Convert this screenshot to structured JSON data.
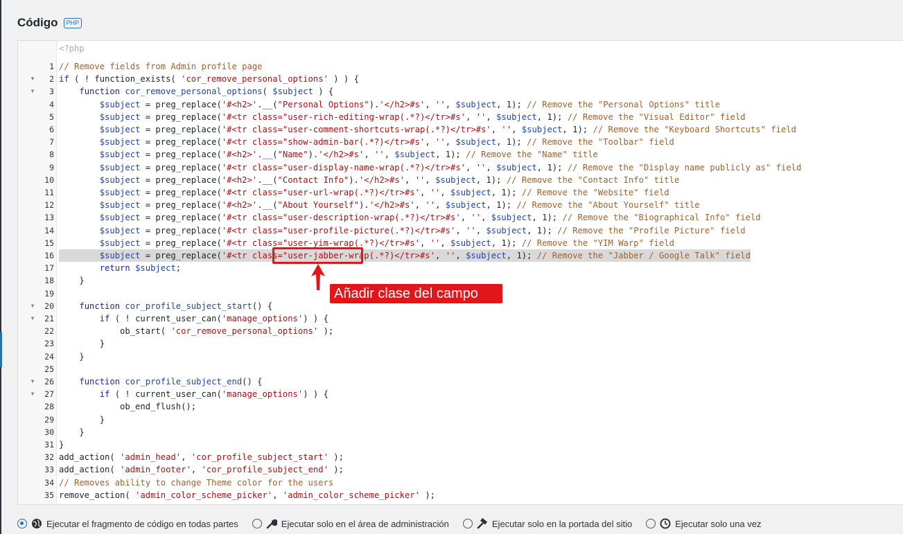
{
  "section": {
    "title": "Código",
    "badge": "PHP"
  },
  "editor": {
    "lines": [
      {
        "num": "",
        "fold": false,
        "html": "<span class=\"c-tag\">&lt;?php</span>"
      },
      {
        "num": "",
        "fold": false,
        "html": ""
      },
      {
        "num": "1",
        "fold": false,
        "html": "<span class=\"c-com\">// Remove fields from Admin profile page</span>"
      },
      {
        "num": "2",
        "fold": true,
        "html": "<span class=\"c-kw\">if</span> ( ! function_exists( <span class=\"c-str\">'cor_remove_personal_options'</span> ) ) {"
      },
      {
        "num": "3",
        "fold": true,
        "html": "    <span class=\"c-kw\">function</span> <span class=\"c-var\">cor_remove_personal_options</span>( <span class=\"c-var\">$subject</span> ) {"
      },
      {
        "num": "4",
        "fold": false,
        "html": "        <span class=\"c-var\">$subject</span> = preg_replace(<span class=\"c-str\">'#&lt;h2&gt;'</span>.__(<span class=\"c-str\">\"Personal Options\"</span>).<span class=\"c-str\">'&lt;/h2&gt;#s'</span>, <span class=\"c-str\">''</span>, <span class=\"c-var\">$subject</span>, 1); <span class=\"c-com\">// Remove the \"Personal Options\" title</span>"
      },
      {
        "num": "5",
        "fold": false,
        "html": "        <span class=\"c-var\">$subject</span> = preg_replace(<span class=\"c-str\">'#&lt;tr class=\"user-rich-editing-wrap(.*?)&lt;/tr&gt;#s'</span>, <span class=\"c-str\">''</span>, <span class=\"c-var\">$subject</span>, 1); <span class=\"c-com\">// Remove the \"Visual Editor\" field</span>"
      },
      {
        "num": "6",
        "fold": false,
        "html": "        <span class=\"c-var\">$subject</span> = preg_replace(<span class=\"c-str\">'#&lt;tr class=\"user-comment-shortcuts-wrap(.*?)&lt;/tr&gt;#s'</span>, <span class=\"c-str\">''</span>, <span class=\"c-var\">$subject</span>, 1); <span class=\"c-com\">// Remove the \"Keyboard Shortcuts\" field</span>"
      },
      {
        "num": "7",
        "fold": false,
        "html": "        <span class=\"c-var\">$subject</span> = preg_replace(<span class=\"c-str\">'#&lt;tr class=\"show-admin-bar(.*?)&lt;/tr&gt;#s'</span>, <span class=\"c-str\">''</span>, <span class=\"c-var\">$subject</span>, 1); <span class=\"c-com\">// Remove the \"Toolbar\" field</span>"
      },
      {
        "num": "8",
        "fold": false,
        "html": "        <span class=\"c-var\">$subject</span> = preg_replace(<span class=\"c-str\">'#&lt;h2&gt;'</span>.__(<span class=\"c-str\">\"Name\"</span>).<span class=\"c-str\">'&lt;/h2&gt;#s'</span>, <span class=\"c-str\">''</span>, <span class=\"c-var\">$subject</span>, 1); <span class=\"c-com\">// Remove the \"Name\" title</span>"
      },
      {
        "num": "9",
        "fold": false,
        "html": "        <span class=\"c-var\">$subject</span> = preg_replace(<span class=\"c-str\">'#&lt;tr class=\"user-display-name-wrap(.*?)&lt;/tr&gt;#s'</span>, <span class=\"c-str\">''</span>, <span class=\"c-var\">$subject</span>, 1); <span class=\"c-com\">// Remove the \"Display name publicly as\" field</span>"
      },
      {
        "num": "10",
        "fold": false,
        "html": "        <span class=\"c-var\">$subject</span> = preg_replace(<span class=\"c-str\">'#&lt;h2&gt;'</span>.__(<span class=\"c-str\">\"Contact Info\"</span>).<span class=\"c-str\">'&lt;/h2&gt;#s'</span>, <span class=\"c-str\">''</span>, <span class=\"c-var\">$subject</span>, 1); <span class=\"c-com\">// Remove the \"Contact Info\" title</span>"
      },
      {
        "num": "11",
        "fold": false,
        "html": "        <span class=\"c-var\">$subject</span> = preg_replace(<span class=\"c-str\">'#&lt;tr class=\"user-url-wrap(.*?)&lt;/tr&gt;#s'</span>, <span class=\"c-str\">''</span>, <span class=\"c-var\">$subject</span>, 1); <span class=\"c-com\">// Remove the \"Website\" field</span>"
      },
      {
        "num": "12",
        "fold": false,
        "html": "        <span class=\"c-var\">$subject</span> = preg_replace(<span class=\"c-str\">'#&lt;h2&gt;'</span>.__(<span class=\"c-str\">\"About Yourself\"</span>).<span class=\"c-str\">'&lt;/h2&gt;#s'</span>, <span class=\"c-str\">''</span>, <span class=\"c-var\">$subject</span>, 1); <span class=\"c-com\">// Remove the \"About Yourself\" title</span>"
      },
      {
        "num": "13",
        "fold": false,
        "html": "        <span class=\"c-var\">$subject</span> = preg_replace(<span class=\"c-str\">'#&lt;tr class=\"user-description-wrap(.*?)&lt;/tr&gt;#s'</span>, <span class=\"c-str\">''</span>, <span class=\"c-var\">$subject</span>, 1); <span class=\"c-com\">// Remove the \"Biographical Info\" field</span>"
      },
      {
        "num": "14",
        "fold": false,
        "html": "        <span class=\"c-var\">$subject</span> = preg_replace(<span class=\"c-str\">'#&lt;tr class=\"user-profile-picture(.*?)&lt;/tr&gt;#s'</span>, <span class=\"c-str\">''</span>, <span class=\"c-var\">$subject</span>, 1); <span class=\"c-com\">// Remove the \"Profile Picture\" field</span>"
      },
      {
        "num": "15",
        "fold": false,
        "html": "        <span class=\"c-var\">$subject</span> = preg_replace(<span class=\"c-str\">'#&lt;tr class=\"user-yim-wrap(.*?)&lt;/tr&gt;#s'</span>, <span class=\"c-str\">''</span>, <span class=\"c-var\">$subject</span>, 1); <span class=\"c-com\">// Remove the \"YIM Warp\" field</span>"
      },
      {
        "num": "16",
        "fold": false,
        "hl": true,
        "html": "        <span class=\"c-var\">$subject</span> = preg_replace(<span class=\"c-str\">'#&lt;tr class=\"user-jabber-wrap(.*?)&lt;/tr&gt;#s'</span>, <span class=\"c-str\">''</span>, <span class=\"c-var\">$subject</span>, 1); <span class=\"c-com\">// Remove the \"Jabber / Google Talk\" field</span>"
      },
      {
        "num": "17",
        "fold": false,
        "html": "        <span class=\"c-kw\">return</span> <span class=\"c-var\">$subject</span>;"
      },
      {
        "num": "18",
        "fold": false,
        "html": "    }"
      },
      {
        "num": "19",
        "fold": false,
        "html": ""
      },
      {
        "num": "20",
        "fold": true,
        "html": "    <span class=\"c-kw\">function</span> <span class=\"c-var\">cor_profile_subject_start</span>() {"
      },
      {
        "num": "21",
        "fold": true,
        "html": "        <span class=\"c-kw\">if</span> ( ! current_user_can(<span class=\"c-str\">'manage_options'</span>) ) {"
      },
      {
        "num": "22",
        "fold": false,
        "html": "            ob_start( <span class=\"c-str\">'cor_remove_personal_options'</span> );"
      },
      {
        "num": "23",
        "fold": false,
        "html": "        }"
      },
      {
        "num": "24",
        "fold": false,
        "html": "    }"
      },
      {
        "num": "25",
        "fold": false,
        "html": ""
      },
      {
        "num": "26",
        "fold": true,
        "html": "    <span class=\"c-kw\">function</span> <span class=\"c-var\">cor_profile_subject_end</span>() {"
      },
      {
        "num": "27",
        "fold": true,
        "html": "        <span class=\"c-kw\">if</span> ( ! current_user_can(<span class=\"c-str\">'manage_options'</span>) ) {"
      },
      {
        "num": "28",
        "fold": false,
        "html": "            ob_end_flush();"
      },
      {
        "num": "29",
        "fold": false,
        "html": "        }"
      },
      {
        "num": "30",
        "fold": false,
        "html": "    }"
      },
      {
        "num": "31",
        "fold": false,
        "html": "}"
      },
      {
        "num": "32",
        "fold": false,
        "html": "add_action( <span class=\"c-str\">'admin_head'</span>, <span class=\"c-str\">'cor_profile_subject_start'</span> );"
      },
      {
        "num": "33",
        "fold": false,
        "html": "add_action( <span class=\"c-str\">'admin_footer'</span>, <span class=\"c-str\">'cor_profile_subject_end'</span> );"
      },
      {
        "num": "34",
        "fold": false,
        "html": "<span class=\"c-com\">// Removes ability to change Theme color for the users</span>"
      },
      {
        "num": "35",
        "fold": false,
        "html": "remove_action( <span class=\"c-str\">'admin_color_scheme_picker'</span>, <span class=\"c-str\">'admin_color_scheme_picker'</span> );"
      }
    ]
  },
  "annotation": {
    "label": "Añadir clase del campo",
    "color": "#e0161b"
  },
  "run_options": [
    {
      "label": "Ejecutar el fragmento de código en todas partes",
      "icon": "globe-icon",
      "selected": true
    },
    {
      "label": "Ejecutar solo en el área de administración",
      "icon": "wrench-icon",
      "selected": false
    },
    {
      "label": "Ejecutar solo en la portada del sitio",
      "icon": "hammer-icon",
      "selected": false
    },
    {
      "label": "Ejecutar solo una vez",
      "icon": "clock-icon",
      "selected": false
    }
  ]
}
